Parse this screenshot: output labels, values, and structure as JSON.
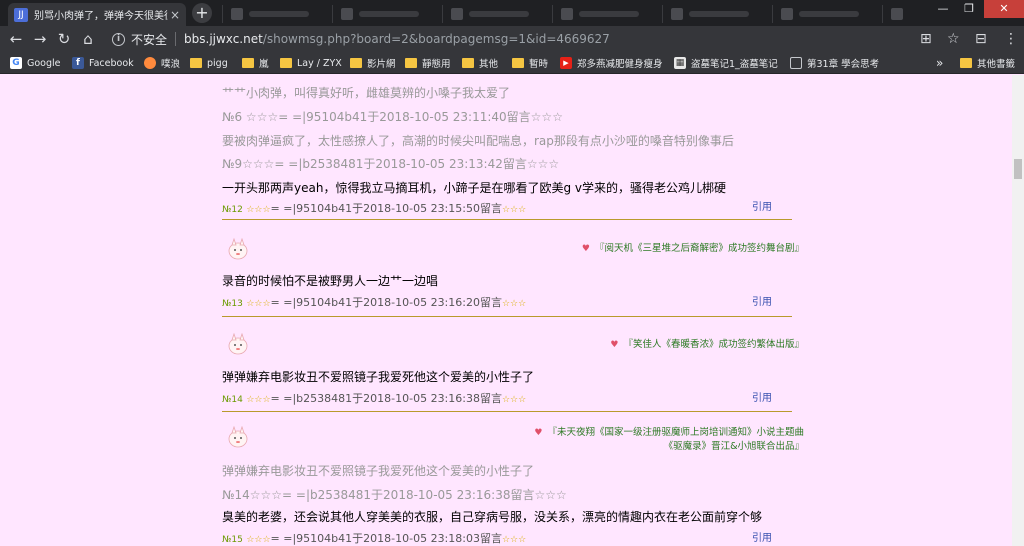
{
  "browser": {
    "tab_title": "别骂小肉弹了，弹弹今天很美很棒",
    "tab_close": "×",
    "new_tab": "+",
    "win_min": "—",
    "win_max": "❐",
    "win_close": "✕",
    "insecure_label": "不安全",
    "url_host": "bbs.jjwxc.net",
    "url_rest": "/showmsg.php?board=2&boardpagemsg=1&id=4669627"
  },
  "bookmarks": [
    {
      "label": "Google",
      "icon": "google-icon"
    },
    {
      "label": "Facebook",
      "icon": "facebook-icon"
    },
    {
      "label": "噗浪",
      "icon": "plurk-icon"
    },
    {
      "label": "pigg",
      "icon": "folder-icon"
    },
    {
      "label": "嵐",
      "icon": "folder-icon"
    },
    {
      "label": "Lay / ZYX",
      "icon": "folder-icon"
    },
    {
      "label": "影片網",
      "icon": "folder-icon"
    },
    {
      "label": "靜態用",
      "icon": "folder-icon"
    },
    {
      "label": "其他",
      "icon": "folder-icon"
    },
    {
      "label": "暫時",
      "icon": "folder-icon"
    },
    {
      "label": "郑多燕减肥健身瘦身",
      "icon": "youtube-icon"
    },
    {
      "label": "盗墓笔记1_盗墓笔记",
      "icon": "site-icon"
    },
    {
      "label": "第31章 學会思考",
      "icon": "page-icon"
    },
    {
      "label": "»",
      "icon": ""
    },
    {
      "label": "其他書籤",
      "icon": "folder-icon"
    }
  ],
  "posts": {
    "top_quote": "艹艹小肉弹，叫得真好听，雌雄莫辨的小嗓子我太爱了",
    "p6_meta": "№6 ☆☆☆= =|95104b41于2018-10-05 23:11:40留言☆☆☆",
    "p9_quote": "要被肉弹逼疯了，太性感撩人了，高潮的时候尖叫配喘息，rap那段有点小沙哑的嗓音特别像事后",
    "p9_meta": "№9☆☆☆= =|b2538481于2018-10-05 23:13:42留言☆☆☆",
    "p12_text": "一开头那两声yeah，惊得我立马摘耳机，小蹄子是在哪看了欧美g v学来的，骚得老公鸡儿梆硬",
    "p12_num": "№12",
    "p12_stars": "☆☆☆",
    "p12_author": "= =|95104b41",
    "p12_yu": "于",
    "p12_time": "2018-10-05 23:15:50留言",
    "p12_stars2": "☆☆☆",
    "p13_sig": "『阅天机《三星堆之后裔解密》成功签约舞台剧』",
    "p13_text": "录音的时候怕不是被野男人一边艹一边唱",
    "p13_num": "№13",
    "p13_stars": "☆☆☆",
    "p13_author": "= =|95104b41",
    "p13_yu": "于",
    "p13_time": "2018-10-05 23:16:20留言",
    "p13_stars2": "☆☆☆",
    "p14_sig": "『笑佳人《春暖香浓》成功签约繁体出版』",
    "p14_text": "弹弹嫌弃电影妆丑不爱照镜子我爱死他这个爱美的小性子了",
    "p14_num": "№14",
    "p14_stars": "☆☆☆",
    "p14_author": "= =|b2538481",
    "p14_yu": "于",
    "p14_time": "2018-10-05 23:16:38留言",
    "p14_stars2": "☆☆☆",
    "p15_sig1": "『未天夜翔《国家一级注册驱魔师上岗培训通知》小说主题曲",
    "p15_sig2": "《驱魔录》晋江&小旭联合出品』",
    "p15_quote": "弹弹嫌弃电影妆丑不爱照镜子我爱死他这个爱美的小性子了",
    "p15_quote_meta": "№14☆☆☆= =|b2538481于2018-10-05 23:16:38留言☆☆☆",
    "p15_text": "臭美的老婆，还会说其他人穿美美的衣服，自己穿病号服，没关系，漂亮的情趣内衣在老公面前穿个够",
    "p15_num": "№15",
    "p15_stars": "☆☆☆",
    "p15_author": "= =|95104b41",
    "p15_yu": "于",
    "p15_time": "2018-10-05 23:18:03留言",
    "p15_stars2": "☆☆☆",
    "reply_label": "引用",
    "heart": "♥"
  }
}
